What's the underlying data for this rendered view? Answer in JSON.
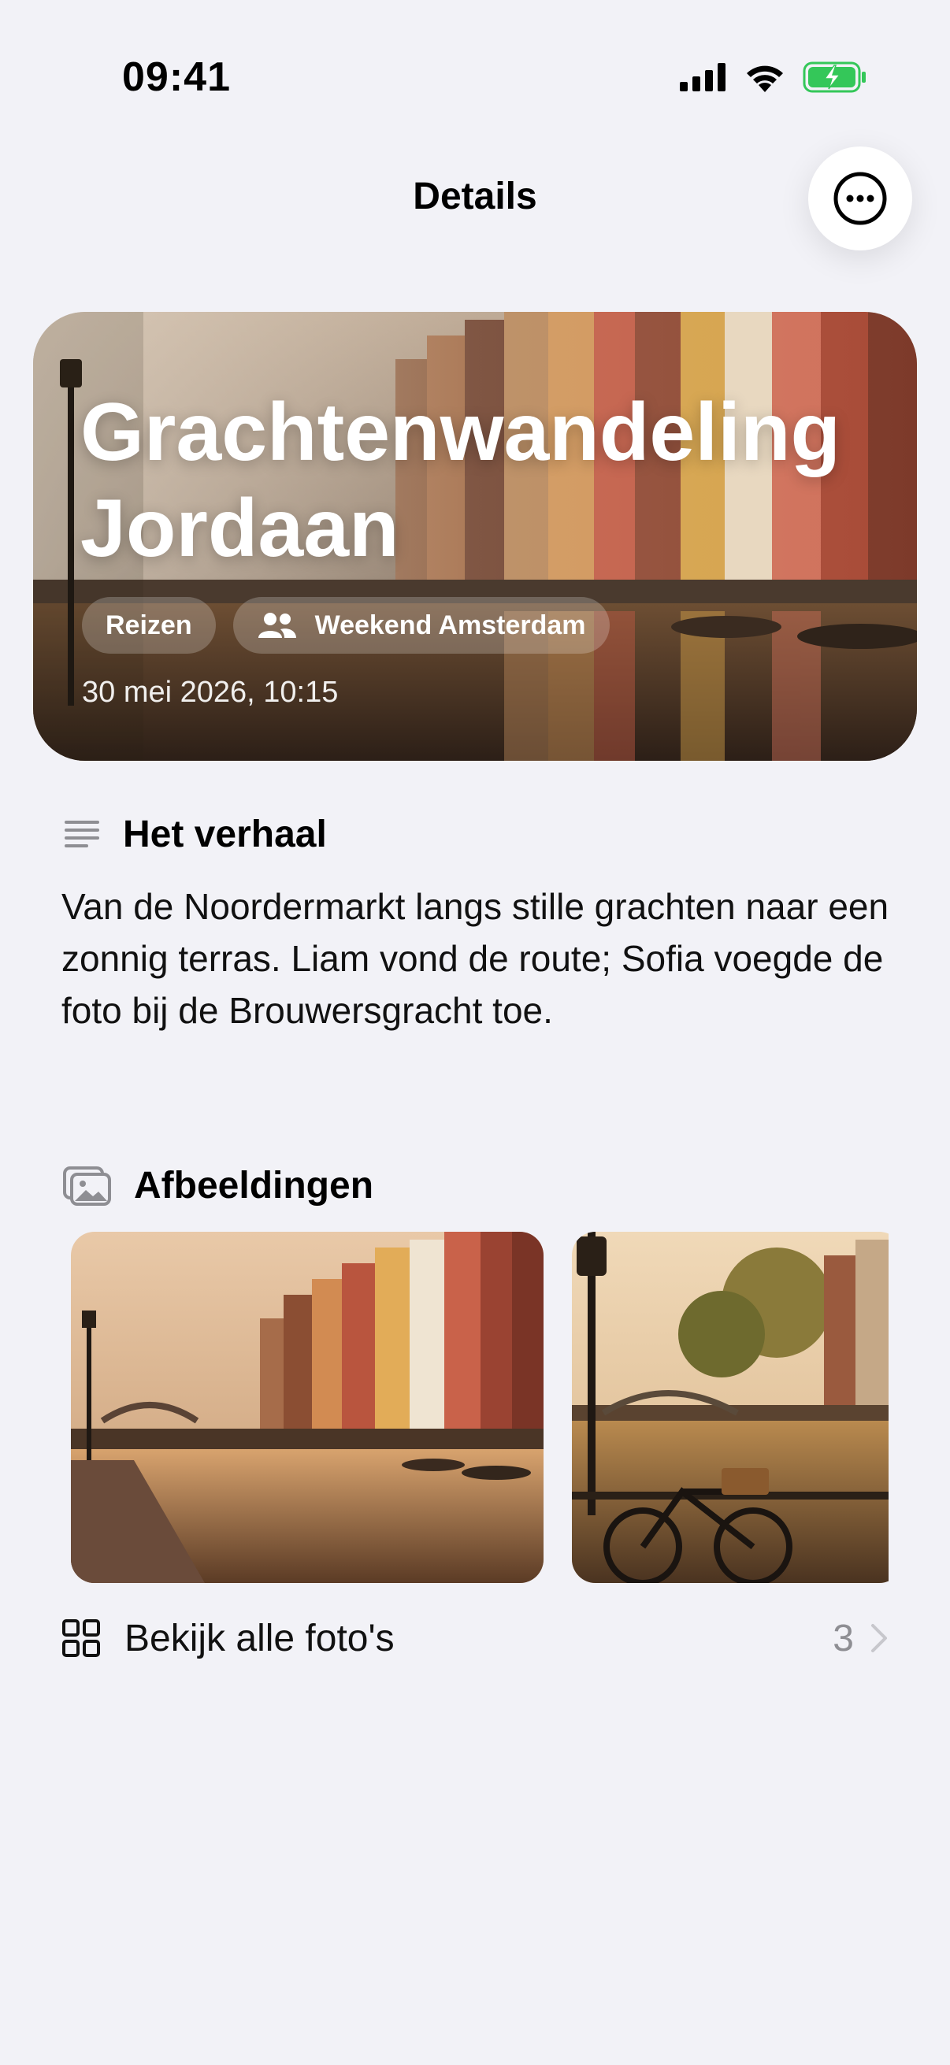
{
  "status_bar": {
    "time": "09:41",
    "icons": [
      "cellular-signal-icon",
      "wifi-icon",
      "battery-charging-icon"
    ],
    "battery_color": "#34c759"
  },
  "nav": {
    "title": "Details",
    "more_icon": "ellipsis-circle-icon"
  },
  "hero": {
    "title": "Grachtenwandeling Jordaan",
    "category_tag": "Reizen",
    "group_icon": "people-icon",
    "group_tag": "Weekend Amsterdam",
    "date": "30 mei 2026, 10:15"
  },
  "story": {
    "icon": "text-lines-icon",
    "title": "Het verhaal",
    "body": "Van de Noordermarkt langs stille grachten naar een zonnig terras. Liam vond de route; Sofia voegde de foto bij de Brouwersgracht toe."
  },
  "images": {
    "icon": "photos-icon",
    "title": "Afbeeldingen",
    "thumbnails": [
      "canal-houses-photo",
      "canal-bicycle-photo"
    ]
  },
  "all_photos": {
    "icon": "grid-icon",
    "label": "Bekijk alle foto's",
    "count": "3",
    "chevron_icon": "chevron-right-icon"
  },
  "colors": {
    "background": "#f2f2f7",
    "secondary_text": "#8e8e93"
  }
}
